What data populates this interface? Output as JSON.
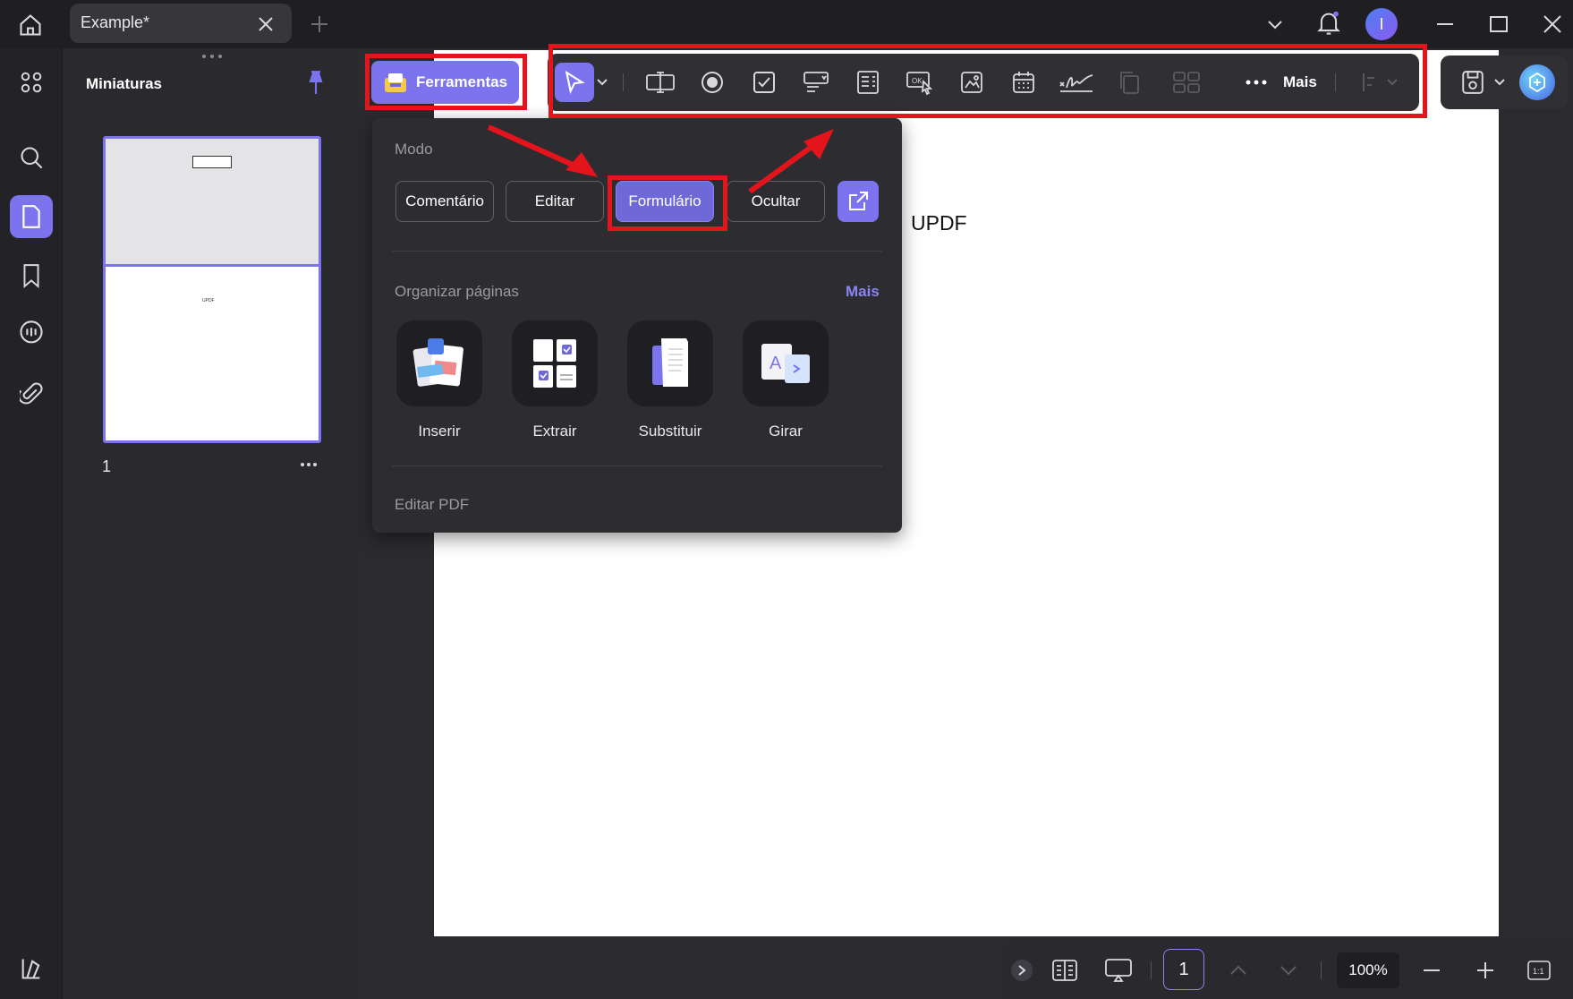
{
  "window": {
    "tab_title": "Example*"
  },
  "sidebar": {
    "panel_title": "Miniaturas",
    "page_number": "1"
  },
  "toolbar": {
    "tools_label": "Ferramentas",
    "more_label": "Mais"
  },
  "document": {
    "text": "UPDF"
  },
  "dropdown": {
    "mode_label": "Modo",
    "modes": [
      "Comentário",
      "Editar",
      "Formulário",
      "Ocultar"
    ],
    "active_mode": "Formulário",
    "organize_label": "Organizar páginas",
    "organize_more": "Mais",
    "organize_items": [
      "Inserir",
      "Extrair",
      "Substituir",
      "Girar"
    ],
    "edit_pdf_label": "Editar PDF"
  },
  "bottom": {
    "current_page": "1",
    "zoom": "100%"
  },
  "user": {
    "avatar_letter": "I"
  },
  "colors": {
    "accent": "#7b74ee",
    "annotation_red": "#e3141b",
    "background": "#2b2b2f"
  }
}
